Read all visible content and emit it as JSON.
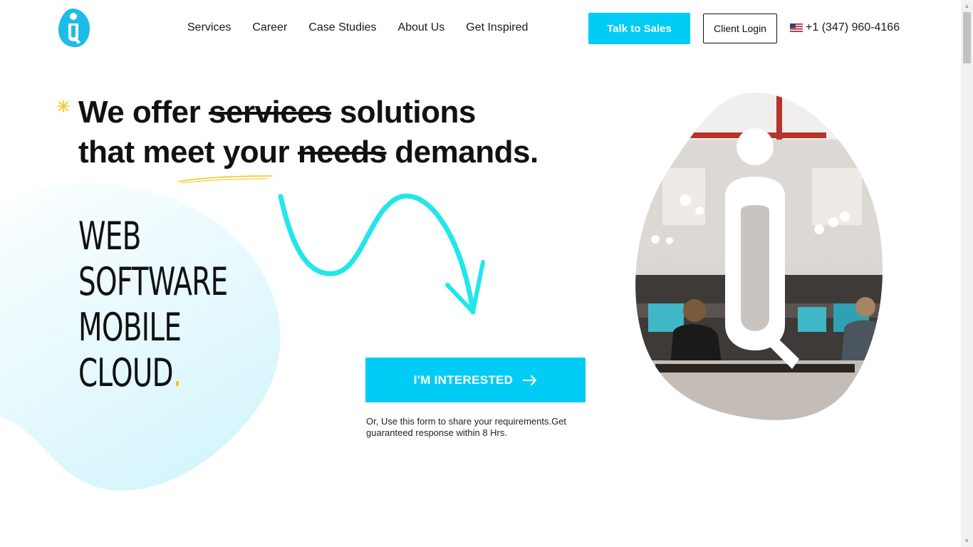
{
  "header": {
    "logo_alt": "Q logo",
    "nav": [
      "Services",
      "Career",
      "Case Studies",
      "About Us",
      "Get Inspired"
    ],
    "talk_to_sales": "Talk to Sales",
    "client_login": "Client Login",
    "phone": "+1 (347) 960-4166",
    "flag_icon": "us-flag-icon"
  },
  "hero": {
    "headline": {
      "part1": "We offer ",
      "struck1": "services",
      "part2": " solutions",
      "part3": "that meet your ",
      "struck2": "needs",
      "part4": " demands."
    },
    "stack": [
      "WEB",
      "SOFTWARE",
      "MOBILE",
      "CLOUD"
    ],
    "stack_dot": ".",
    "cta_label": "I'M INTERESTED",
    "cta_icon": "arrow-right-icon",
    "cta_note": "Or, Use this form to share your requirements.Get guaranteed response within 8 Hrs."
  },
  "colors": {
    "accent": "#00ccf5",
    "highlight": "#f5c518",
    "blob": "#e3f8fd",
    "text": "#111111"
  }
}
